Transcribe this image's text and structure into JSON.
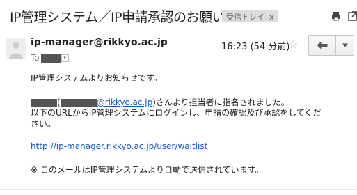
{
  "header": {
    "subject": "IP管理システム／IP申請承認のお願い",
    "label": "受信トレイ",
    "label_remove": "x",
    "print_icon": "printer-icon",
    "popout_icon": "new-window-icon"
  },
  "message": {
    "sender": "ip-manager@rikkyo.ac.jp",
    "to_label": "To",
    "time": "16:23 (54 分前)",
    "star_icon": "star-outline-icon",
    "reply_icon": "reply-arrow-icon",
    "more_icon": "caret-down-icon"
  },
  "body": {
    "line1": "IP管理システムよりお知らせです。",
    "open_paren": "(",
    "email_domain": "@rikkyo.ac.jp",
    "close_paren_text": ")さんより担当者に指名されました。",
    "line3": "以下のURLからIP管理システムにログインし、申請の確認及び承認をしてくだ",
    "line4": "さい。",
    "link": "http://ip-manager.rikkyo.ac.jp/user/waitlist",
    "footer": "※ このメールはIP管理システムより自動で送信されています。"
  },
  "colors": {
    "link": "#1155cc",
    "badge_bg": "#dddddd",
    "redaction": "#555555"
  }
}
